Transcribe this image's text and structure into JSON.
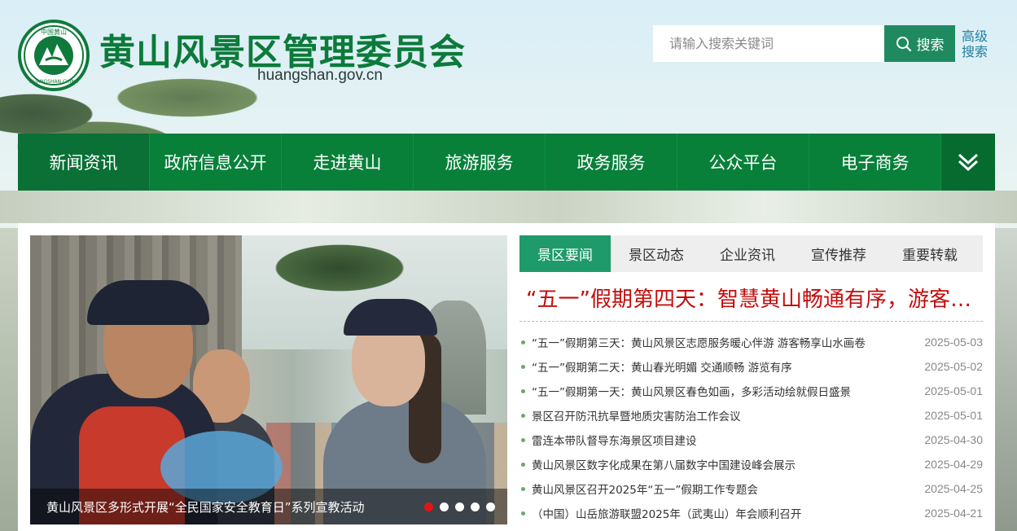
{
  "header": {
    "site_title": "黄山风景区管理委员会",
    "domain": "huangshan.gov.cn",
    "emblem_text_top": "中国黄山",
    "emblem_text_bottom": "HUANGSHAN CHINA"
  },
  "search": {
    "placeholder": "请输入搜索关键词",
    "button_label": "搜索",
    "advanced_label": "高级搜索"
  },
  "nav": {
    "items": [
      "新闻资讯",
      "政府信息公开",
      "走进黄山",
      "旅游服务",
      "政务服务",
      "公众平台",
      "电子商务"
    ]
  },
  "slideshow": {
    "caption": "黄山风景区多形式开展“全民国家安全教育日”系列宣教活动",
    "dot_count": 5,
    "active_index": 0
  },
  "tabs": [
    "景区要闻",
    "景区动态",
    "企业资讯",
    "宣传推荐",
    "重要转载"
  ],
  "headline": "“五一”假期第四天：智慧黄山畅通有序，游客乐享美景",
  "news": [
    {
      "title": "“五一”假期第三天：黄山风景区志愿服务暖心伴游 游客畅享山水画卷",
      "date": "2025-05-03"
    },
    {
      "title": "“五一”假期第二天：黄山春光明媚 交通顺畅 游览有序",
      "date": "2025-05-02"
    },
    {
      "title": "“五一”假期第一天：黄山风景区春色如画，多彩活动绘就假日盛景",
      "date": "2025-05-01"
    },
    {
      "title": "景区召开防汛抗旱暨地质灾害防治工作会议",
      "date": "2025-05-01"
    },
    {
      "title": "雷连本带队督导东海景区项目建设",
      "date": "2025-04-30"
    },
    {
      "title": "黄山风景区数字化成果在第八届数字中国建设峰会展示",
      "date": "2025-04-29"
    },
    {
      "title": "黄山风景区召开2025年“五一”假期工作专题会",
      "date": "2025-04-25"
    },
    {
      "title": "（中国）山岳旅游联盟2025年（武夷山）年会顺利召开",
      "date": "2025-04-21"
    }
  ],
  "colors": {
    "brand_green": "#08803a",
    "tab_active": "#1f9a6b",
    "headline_red": "#c40d0d"
  }
}
